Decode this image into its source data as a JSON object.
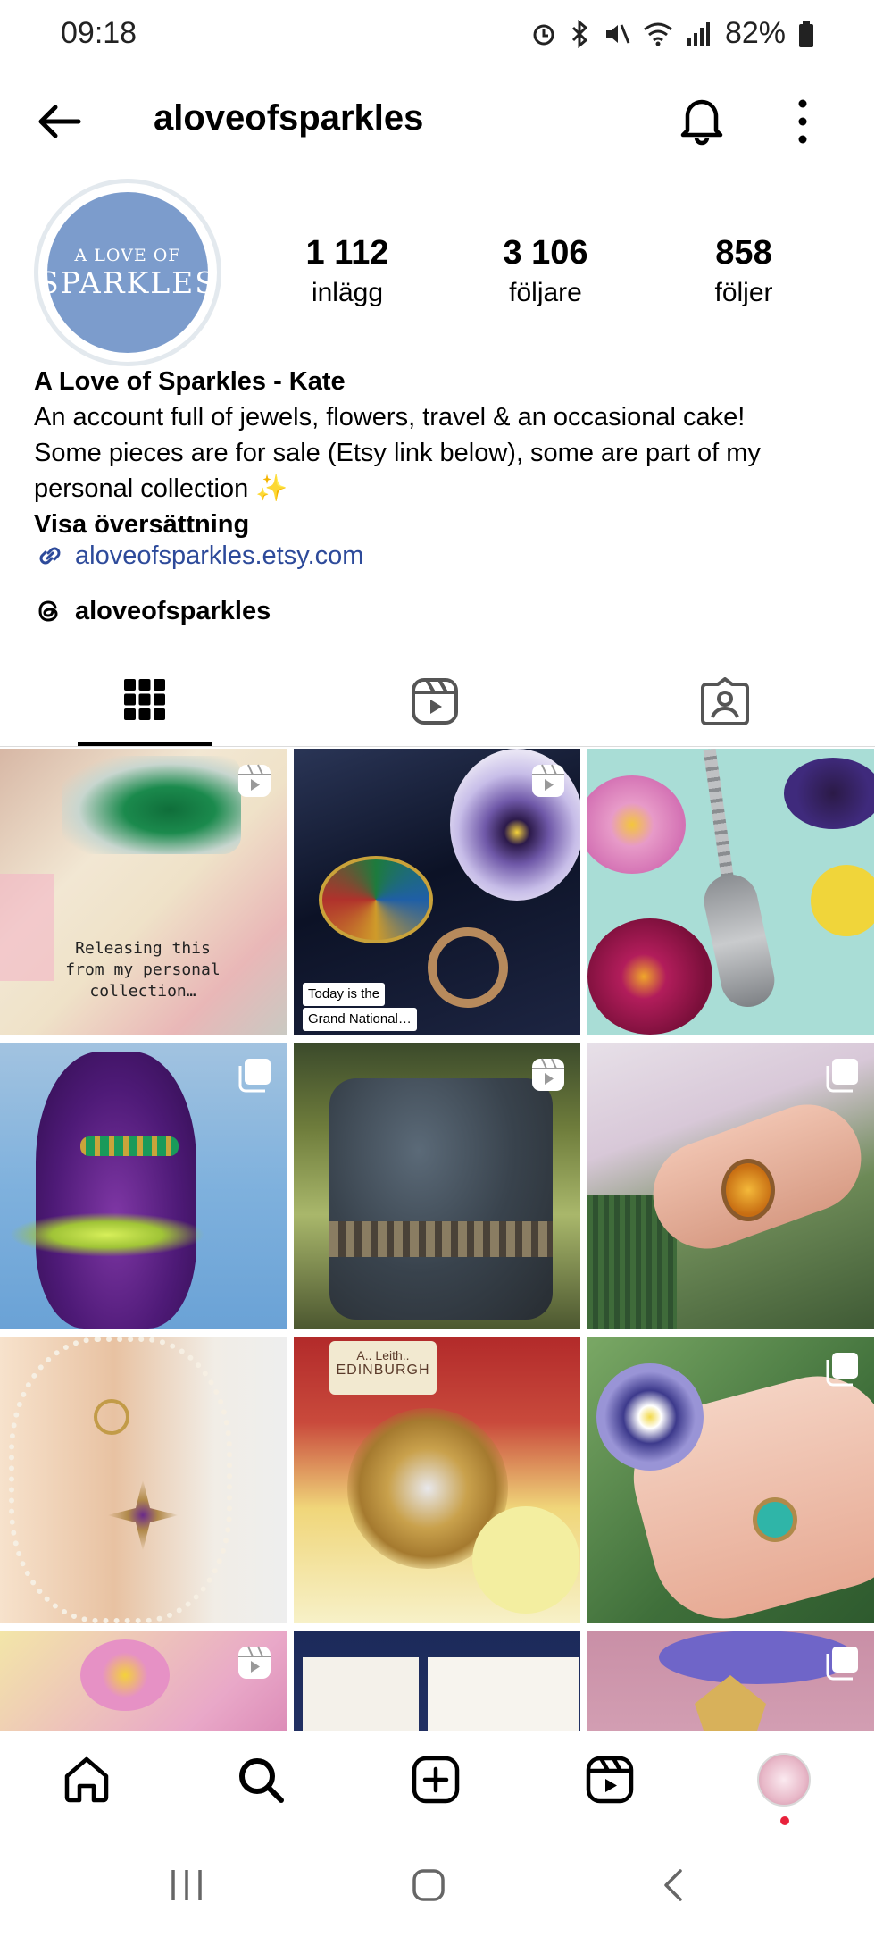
{
  "status": {
    "time": "09:18",
    "battery": "82%"
  },
  "header": {
    "username": "aloveofsparkles"
  },
  "avatar": {
    "line1": "A LOVE OF",
    "line2": "SPARKLES"
  },
  "stats": [
    {
      "value": "1 112",
      "label": "inlägg"
    },
    {
      "value": "3 106",
      "label": "följare"
    },
    {
      "value": "858",
      "label": "följer"
    }
  ],
  "bio": {
    "name": "A Love of Sparkles - Kate",
    "line1": "An account full of jewels, flowers, travel & an occasional cake!",
    "line2": "Some pieces are for sale (Etsy link below), some are part of my",
    "line3": "personal collection ✨",
    "translate": "Visa översättning",
    "link": "aloveofsparkles.etsy.com",
    "threads": "aloveofsparkles"
  },
  "posts": [
    {
      "id": "p1",
      "caption": "Releasing this from my personal collection…",
      "badge": "reel"
    },
    {
      "id": "p2",
      "caption": "Today is the Grand National…",
      "badge": "reel"
    },
    {
      "id": "p3",
      "caption": "",
      "badge": "none"
    },
    {
      "id": "p4",
      "caption": "",
      "badge": "carousel"
    },
    {
      "id": "p5",
      "caption": "",
      "badge": "reel"
    },
    {
      "id": "p6",
      "caption": "",
      "badge": "carousel"
    },
    {
      "id": "p7",
      "caption": "",
      "badge": "none"
    },
    {
      "id": "p8",
      "caption": "",
      "badge": "none"
    },
    {
      "id": "p9",
      "caption": "",
      "badge": "carousel"
    }
  ],
  "p1cap": {
    "l1": "Releasing this",
    "l2": "from my personal",
    "l3": "collection…"
  },
  "p2cap": {
    "l1": "Today is the",
    "l2": "Grand National…"
  },
  "p8label": {
    "l1": "A.. Leith..",
    "l2": "EDINBURGH"
  },
  "nav": [
    "home-icon",
    "search-icon",
    "create-icon",
    "reels-icon",
    "profile-avatar"
  ],
  "colors": {
    "link": "#2d4a9a",
    "avatar": "#7c9ccc",
    "notification_dot": "#e8213b"
  }
}
